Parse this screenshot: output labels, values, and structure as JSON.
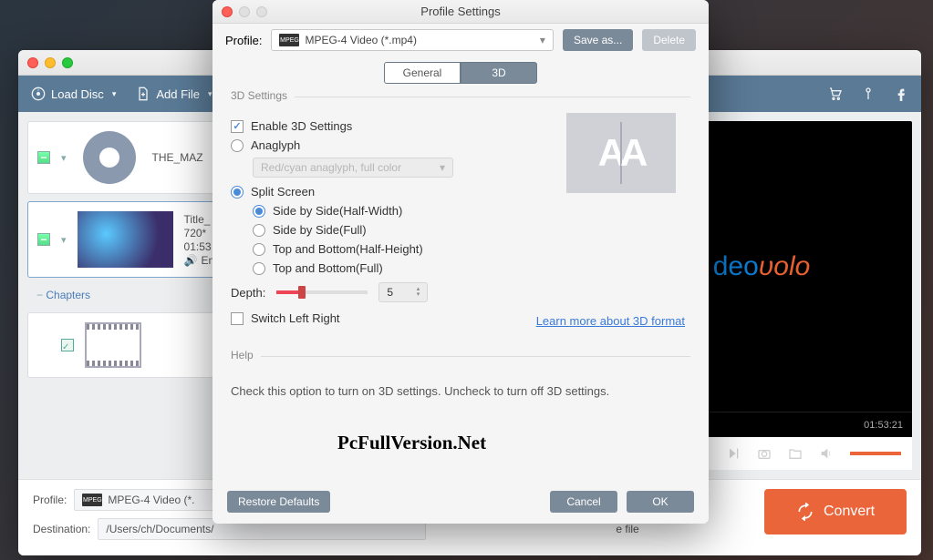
{
  "main": {
    "toolbar": {
      "loadDisc": "Load Disc",
      "addFile": "Add File"
    },
    "items": {
      "discTitle": "THE_MAZ",
      "videoLine1": "Title_",
      "videoLine2": "720*",
      "videoLine3": "01:53",
      "videoAudio": "En",
      "chapters": "Chapters"
    },
    "preview": {
      "brand1": "deo",
      "brand2": "ʋolo",
      "time": "01:53:21"
    },
    "footer": {
      "profileLabel": "Profile:",
      "profileValue": "MPEG-4 Video (*.",
      "destLabel": "Destination:",
      "destValue": "/Users/ch/Documents/",
      "mergeText": "e file",
      "convert": "Convert"
    }
  },
  "modal": {
    "title": "Profile Settings",
    "profileLabel": "Profile:",
    "profileValue": "MPEG-4 Video (*.mp4)",
    "saveAs": "Save as...",
    "delete": "Delete",
    "tabs": {
      "general": "General",
      "threeD": "3D"
    },
    "group3d": "3D Settings",
    "enable3d": "Enable 3D Settings",
    "anaglyph": "Anaglyph",
    "anaglyphSelect": "Red/cyan anaglyph, full color",
    "splitScreen": "Split Screen",
    "opts": {
      "sbsHalf": "Side by Side(Half-Width)",
      "sbsFull": "Side by Side(Full)",
      "tbHalf": "Top and Bottom(Half-Height)",
      "tbFull": "Top and Bottom(Full)"
    },
    "depthLabel": "Depth:",
    "depthValue": "5",
    "switchLR": "Switch Left Right",
    "learnMore": "Learn more about 3D format",
    "helpTitle": "Help",
    "helpBody": "Check this option to turn on 3D settings. Uncheck to turn off 3D settings.",
    "restore": "Restore Defaults",
    "cancel": "Cancel",
    "ok": "OK"
  },
  "watermark": "PcFullVersion.Net"
}
